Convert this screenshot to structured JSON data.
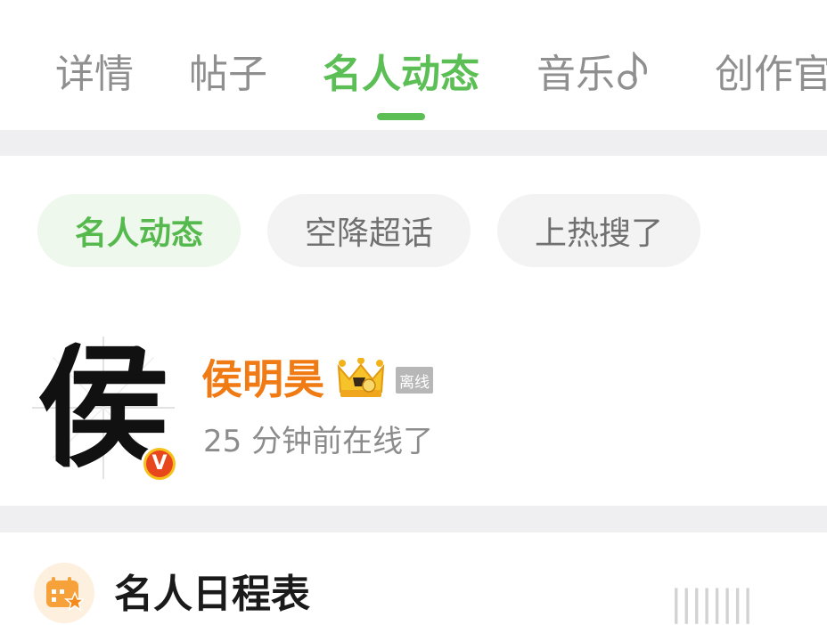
{
  "tabs": [
    {
      "label": "详情",
      "active": false
    },
    {
      "label": "帖子",
      "active": false
    },
    {
      "label": "名人动态",
      "active": true
    },
    {
      "label": "音乐",
      "active": false
    },
    {
      "label": "创作官",
      "active": false
    }
  ],
  "chips": [
    {
      "label": "名人动态",
      "active": true
    },
    {
      "label": "空降超话",
      "active": false
    },
    {
      "label": "上热搜了",
      "active": false
    }
  ],
  "celebrity": {
    "avatar_char": "侯",
    "verified_badge": "V",
    "name": "侯明昊",
    "status_badge": "离线",
    "last_online": "25 分钟前在线了"
  },
  "schedule": {
    "title": "名人日程表"
  },
  "colors": {
    "accent_green": "#5bbf55",
    "name_orange": "#f07a14",
    "divider_gray": "#efeff2"
  },
  "icons": [
    "music-note-icon",
    "crown-level-icon",
    "verified-v-icon",
    "calendar-star-icon"
  ],
  "watermark": "||||||||"
}
